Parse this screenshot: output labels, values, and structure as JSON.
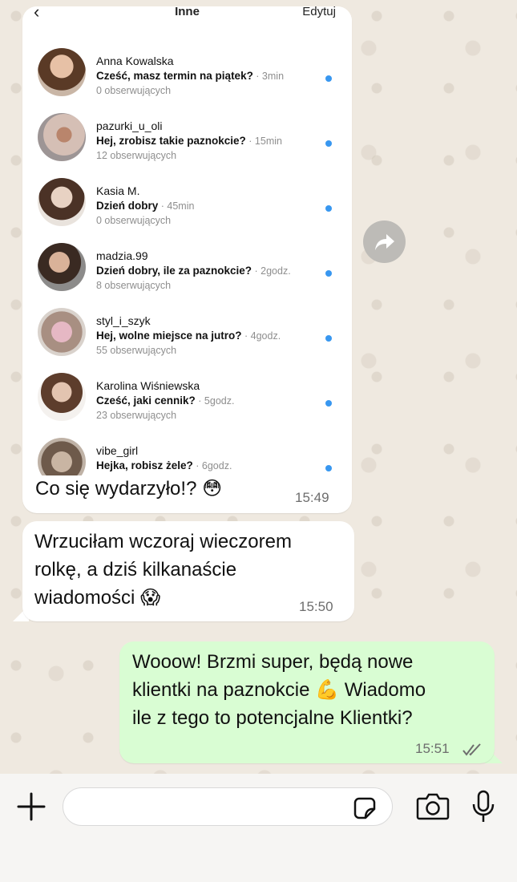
{
  "instagram": {
    "back_icon": "chevron-left-icon",
    "title": "Inne",
    "edit_label": "Edytuj",
    "messages": [
      {
        "name": "Anna Kowalska",
        "preview": "Cześć, masz termin na piątek?",
        "time": " · 3min",
        "followers": "0 obserwujących",
        "unread": true
      },
      {
        "name": "pazurki_u_oli",
        "preview": "Hej, zrobisz takie paznokcie?",
        "time": " · 15min",
        "followers": "12 obserwujących",
        "unread": true
      },
      {
        "name": "Kasia M.",
        "preview": "Dzień dobry",
        "time": " · 45min",
        "followers": "0 obserwujących",
        "unread": true
      },
      {
        "name": "madzia.99",
        "preview": "Dzień dobry, ile za paznokcie?",
        "time": " · 2godz.",
        "followers": "8 obserwujących",
        "unread": true
      },
      {
        "name": "styl_i_szyk",
        "preview": "Hej, wolne miejsce na jutro?",
        "time": " · 4godz.",
        "followers": "55 obserwujących",
        "unread": true
      },
      {
        "name": "Karolina Wiśniewska",
        "preview": "Cześć, jaki cennik?",
        "time": " · 5godz.",
        "followers": "23 obserwujących",
        "unread": true
      },
      {
        "name": "vibe_girl",
        "preview": "Hejka, robisz żele?",
        "time": " · 6godz.",
        "followers": "",
        "unread": true
      }
    ]
  },
  "chat": {
    "image_message": {
      "caption": "Co się wydarzyło!?",
      "emoji": "😳",
      "time": "15:49"
    },
    "incoming_message": {
      "line1": "Wrzuciłam wczoraj wieczorem",
      "line2": "rolkę, a dziś kilkanaście",
      "line3": "wiadomości",
      "emoji": "😱",
      "time": "15:50"
    },
    "outgoing_message": {
      "line1": "Wooow! Brzmi super, będą nowe",
      "line2": "klientki na paznokcie",
      "emoji": "💪",
      "line2b": " Wiadomo",
      "line3": "ile z tego to potencjalne Klientki?",
      "time": "15:51",
      "status_icon": "double-check-icon"
    }
  },
  "input_bar": {
    "value": "",
    "icons": [
      "plus-icon",
      "sticker-icon",
      "camera-icon",
      "microphone-icon"
    ]
  },
  "colors": {
    "outgoing_bubble": "#d9fdd3",
    "incoming_bubble": "#ffffff",
    "unread_dot": "#3897f0",
    "wallpaper": "#efe9e0"
  }
}
